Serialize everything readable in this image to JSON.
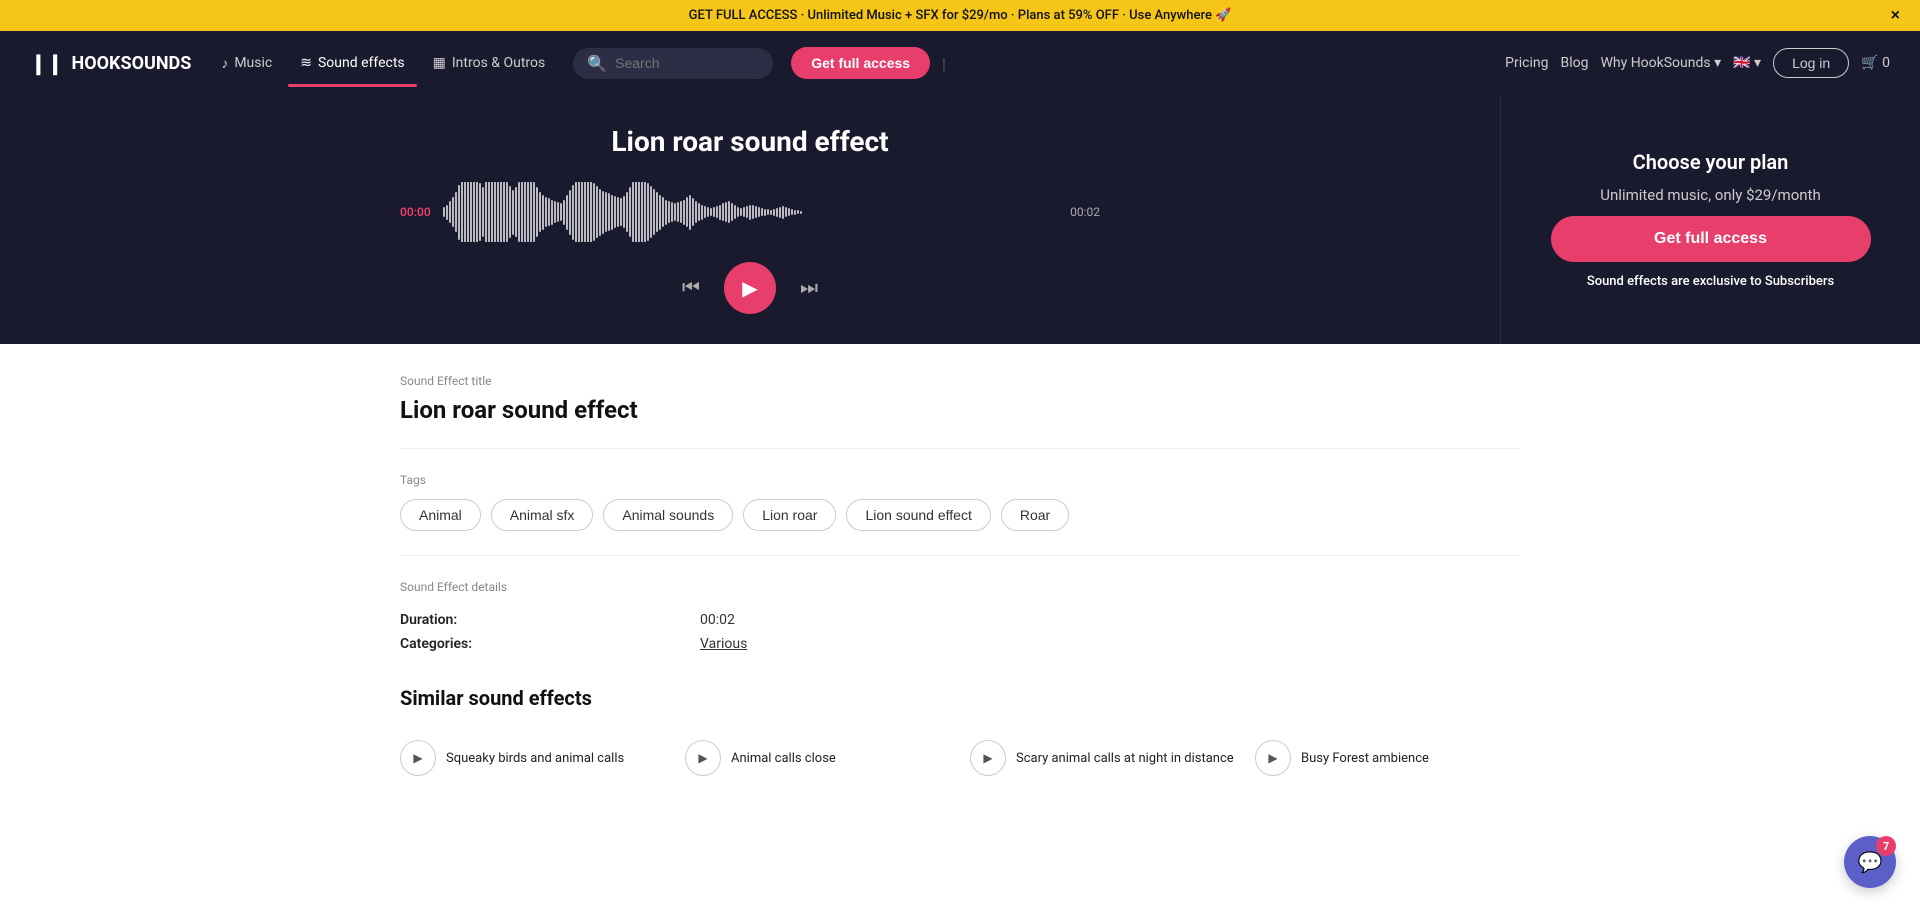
{
  "banner": {
    "text": "GET FULL ACCESS · Unlimited Music + SFX for $29/mo · Plans at 59% OFF · Use Anywhere 🚀",
    "close_label": "×"
  },
  "header": {
    "logo_text": "HOOKSOUNDS",
    "nav": [
      {
        "label": "Music",
        "icon": "♪",
        "active": false
      },
      {
        "label": "Sound effects",
        "icon": "≋",
        "active": true
      },
      {
        "label": "Intros & Outros",
        "icon": "▦",
        "active": false
      }
    ],
    "search_placeholder": "Search",
    "cta_label": "Get full access",
    "right_links": [
      {
        "label": "Pricing"
      },
      {
        "label": "Blog"
      },
      {
        "label": "Why HookSounds ▾"
      }
    ],
    "lang": "🇬🇧 ▾",
    "login_label": "Log in",
    "cart_label": "🛒 0"
  },
  "hero": {
    "title": "Lion roar sound effect",
    "time_start": "00:00",
    "time_end": "00:02",
    "plan_heading": "Choose your plan",
    "plan_subheading": "Unlimited music, only $29/month",
    "plan_cta": "Get full access",
    "exclusive_note": "Sound effects are exclusive to Subscribers"
  },
  "content": {
    "section_label": "Sound Effect title",
    "section_title": "Lion roar sound effect",
    "tags_label": "Tags",
    "tags": [
      "Animal",
      "Animal sfx",
      "Animal sounds",
      "Lion roar",
      "Lion sound effect",
      "Roar"
    ],
    "details_label": "Sound Effect details",
    "details": [
      {
        "key": "Duration:",
        "value": "00:02"
      },
      {
        "key": "Categories:",
        "value": "Various",
        "link": true
      }
    ]
  },
  "similar": {
    "title": "Similar sound effects",
    "items": [
      {
        "name": "Squeaky birds and animal calls"
      },
      {
        "name": "Animal calls close"
      },
      {
        "name": "Scary animal calls at night in distance"
      },
      {
        "name": "Busy Forest ambience"
      }
    ]
  },
  "chat": {
    "icon": "💬",
    "badge": "7"
  }
}
